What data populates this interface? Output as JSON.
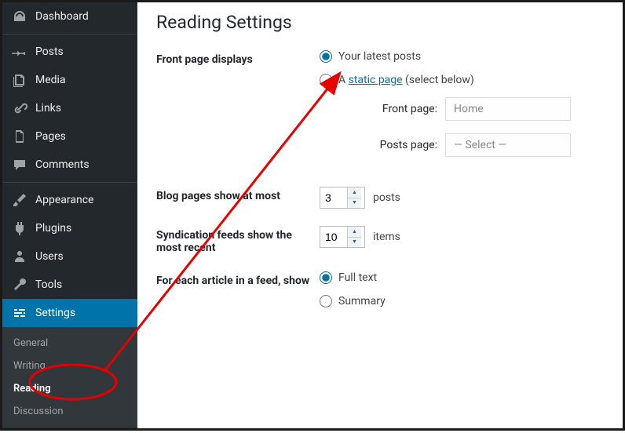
{
  "sidebar": {
    "items": [
      {
        "label": "Dashboard"
      },
      {
        "label": "Posts"
      },
      {
        "label": "Media"
      },
      {
        "label": "Links"
      },
      {
        "label": "Pages"
      },
      {
        "label": "Comments"
      },
      {
        "label": "Appearance"
      },
      {
        "label": "Plugins"
      },
      {
        "label": "Users"
      },
      {
        "label": "Tools"
      },
      {
        "label": "Settings"
      }
    ]
  },
  "submenu": {
    "items": [
      {
        "label": "General"
      },
      {
        "label": "Writing"
      },
      {
        "label": "Reading"
      },
      {
        "label": "Discussion"
      }
    ]
  },
  "page": {
    "title": "Reading Settings"
  },
  "front_page": {
    "label": "Front page displays",
    "opt_latest": "Your latest posts",
    "opt_static_prefix": "A ",
    "opt_static_link": "static page",
    "opt_static_suffix": " (select below)",
    "front_label": "Front page:",
    "front_value": "Home",
    "posts_label": "Posts page:",
    "posts_value": "— Select —"
  },
  "blog_pages": {
    "label": "Blog pages show at most",
    "value": "3",
    "unit": "posts"
  },
  "syndication": {
    "label": "Syndication feeds show the most recent",
    "value": "10",
    "unit": "items"
  },
  "feed_article": {
    "label": "For each article in a feed, show",
    "opt_full": "Full text",
    "opt_summary": "Summary"
  }
}
